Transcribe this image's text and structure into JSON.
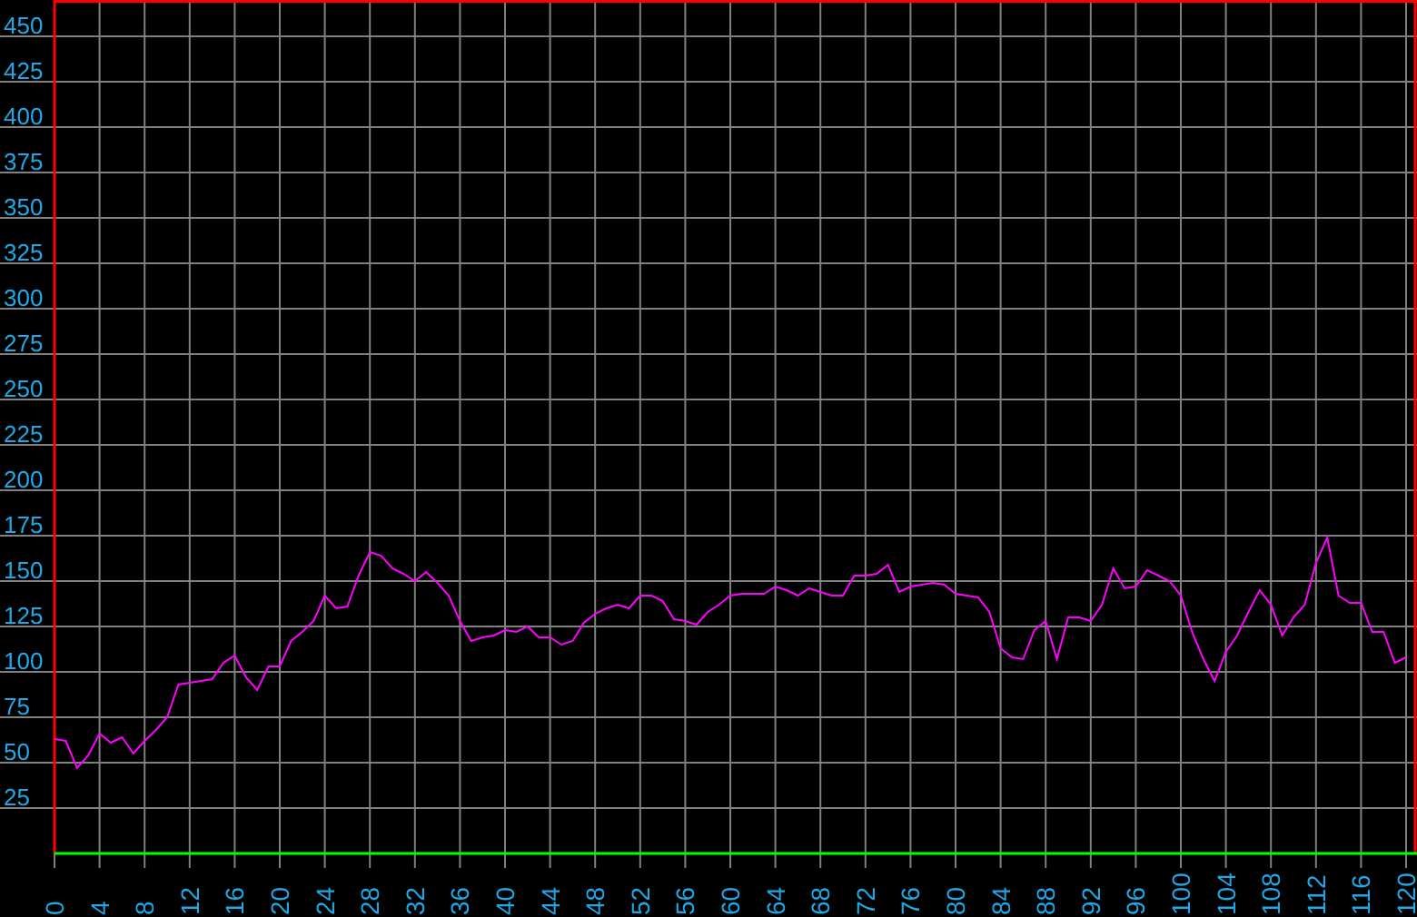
{
  "chart_data": {
    "type": "line",
    "x": [
      0,
      1,
      2,
      3,
      4,
      5,
      6,
      7,
      8,
      9,
      10,
      11,
      12,
      13,
      14,
      15,
      16,
      17,
      18,
      19,
      20,
      21,
      22,
      23,
      24,
      25,
      26,
      27,
      28,
      29,
      30,
      31,
      32,
      33,
      34,
      35,
      36,
      37,
      38,
      39,
      40,
      41,
      42,
      43,
      44,
      45,
      46,
      47,
      48,
      49,
      50,
      51,
      52,
      53,
      54,
      55,
      56,
      57,
      58,
      59,
      60,
      61,
      62,
      63,
      64,
      65,
      66,
      67,
      68,
      69,
      70,
      71,
      72,
      73,
      74,
      75,
      76,
      77,
      78,
      79,
      80,
      81,
      82,
      83,
      84,
      85,
      86,
      87,
      88,
      89,
      90,
      91,
      92,
      93,
      94,
      95,
      96,
      97,
      98,
      99,
      100,
      101,
      102,
      103,
      104,
      105,
      106,
      107,
      108,
      109,
      110,
      111,
      112,
      113,
      114,
      115,
      116,
      117,
      118,
      119,
      120
    ],
    "series": [
      {
        "color": "#ff00ff",
        "values": [
          63,
          62,
          47,
          54,
          66,
          61,
          64,
          55,
          62,
          68,
          75,
          93,
          94,
          95,
          96,
          105,
          109,
          97,
          90,
          103,
          103,
          117,
          122,
          128,
          142,
          135,
          136,
          153,
          166,
          164,
          157,
          154,
          150,
          155,
          149,
          142,
          128,
          117,
          119,
          120,
          123,
          122,
          125,
          119,
          119,
          115,
          117,
          127,
          132,
          135,
          137,
          135,
          142,
          142,
          139,
          129,
          128,
          126,
          133,
          137,
          142,
          143,
          143,
          143,
          147,
          145,
          142,
          146,
          144,
          142,
          142,
          153,
          153,
          154,
          159,
          144,
          147,
          148,
          149,
          148,
          143,
          142,
          141,
          133,
          113,
          108,
          107,
          123,
          128,
          107,
          130,
          130,
          128,
          137,
          157,
          146,
          147,
          156,
          153,
          150,
          142,
          122,
          107,
          95,
          111,
          120,
          133,
          145,
          137,
          120,
          130,
          137,
          160,
          174,
          142,
          138,
          138,
          122,
          122,
          105,
          108
        ]
      }
    ],
    "grid": true,
    "xlim": [
      0,
      120
    ],
    "ylim": [
      0,
      470
    ],
    "xticks": [
      0,
      4,
      8,
      12,
      16,
      20,
      24,
      28,
      32,
      36,
      40,
      44,
      48,
      52,
      56,
      60,
      64,
      68,
      72,
      76,
      80,
      84,
      88,
      92,
      96,
      100,
      104,
      108,
      112,
      116,
      120
    ],
    "yticks": [
      25,
      50,
      75,
      100,
      125,
      150,
      175,
      200,
      225,
      250,
      275,
      300,
      325,
      350,
      375,
      400,
      425,
      450
    ]
  }
}
